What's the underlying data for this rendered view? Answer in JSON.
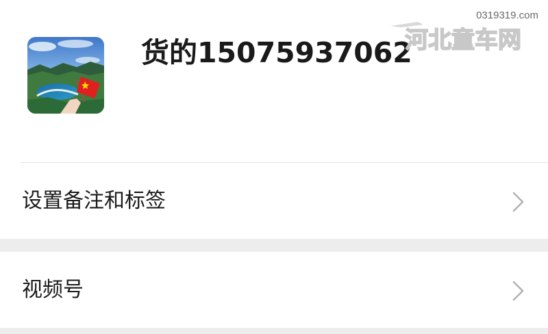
{
  "profile": {
    "nickname": "货的15075937062",
    "avatar_name": "avatar-landscape-flag"
  },
  "list": {
    "items": [
      {
        "label": "设置备注和标签",
        "icon": "chevron-right-icon"
      },
      {
        "label": "视频号",
        "icon": "chevron-right-icon"
      }
    ]
  },
  "watermark": {
    "url": "0319319.com",
    "logo_text": "河北童车网"
  },
  "colors": {
    "background": "#ededed",
    "card": "#ffffff",
    "text": "#1a1a1a",
    "chevron": "#b2b2b2",
    "divider": "#e3e3e3"
  }
}
